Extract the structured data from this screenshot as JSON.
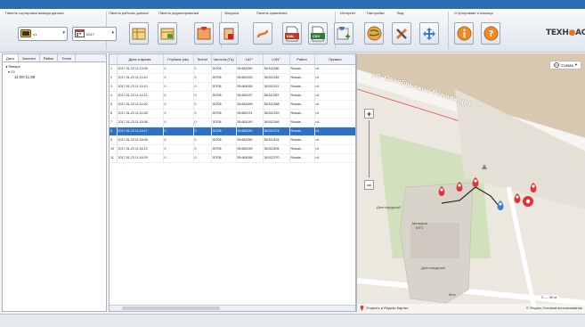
{
  "ribbon": {
    "groups": {
      "sort": "Панель сортировки вывода данных",
      "workspace": "Панель рабочих данных",
      "edit": "Панель редактирования",
      "load": "Загрузка",
      "compare": "Панель сравнения",
      "internet": "Интернет",
      "settings": "Настройки",
      "view": "Вид",
      "about": "О программе и помощь"
    },
    "device_select": {
      "value": "x1"
    },
    "year_select": {
      "value": "2017"
    },
    "buttons": {
      "kml": "KML",
      "csv": "CSV"
    },
    "logo": {
      "part1": "ТЕХН",
      "dot": "●",
      "part2": "АС"
    }
  },
  "left_panel": {
    "tabs": [
      "Дата",
      "Частота",
      "Район",
      "Тесты"
    ],
    "tree": {
      "month": "Январь",
      "day": "23",
      "interval": "11:00-11:59"
    }
  },
  "table": {
    "columns": [
      "",
      "Дата и время",
      "Глубина (км)",
      "TechId",
      "Частота (Гц)",
      "LAT°",
      "LON°",
      "Район",
      "Примеч."
    ],
    "rows": [
      [
        "1",
        "2017-01-23 11:13:08",
        "0",
        "0",
        "30708",
        "55.681050",
        "38.812280",
        "Russia...",
        "n1"
      ],
      [
        "2",
        "2017-01-23 11:13:10",
        "0",
        "0",
        "30708",
        "55.681053",
        "38.812282",
        "Russia...",
        "n1"
      ],
      [
        "3",
        "2017-01-23 11:14:10",
        "0",
        "0",
        "30708",
        "55.681055",
        "38.812311",
        "Russia...",
        "n1"
      ],
      [
        "4",
        "2017-01-23 11:14:13",
        "0",
        "0",
        "30708",
        "55.681037",
        "38.812357",
        "Russia...",
        "n1"
      ],
      [
        "5",
        "2017-01-23 11:14:20",
        "0",
        "0",
        "30708",
        "55.681069",
        "38.812368",
        "Russia...",
        "n1"
      ],
      [
        "6",
        "2017-01-23 11:14:28",
        "0",
        "0",
        "30708",
        "55.681074",
        "38.812339",
        "Russia...",
        "n1"
      ],
      [
        "7",
        "2017-01-23 11:15:08",
        "0",
        "0",
        "30708",
        "55.681049",
        "38.812346",
        "Russia...",
        "n1"
      ],
      [
        "8",
        "2017-01-23 11:15:17",
        "0",
        "0",
        "30708",
        "55.681050",
        "38.812374",
        "Russia...",
        "n1"
      ],
      [
        "9",
        "2017-01-23 11:16:08",
        "0",
        "0",
        "30708",
        "55.681050",
        "38.812404",
        "Russia...",
        "n1"
      ],
      [
        "10",
        "2017-01-23 11:16:13",
        "0",
        "0",
        "30708",
        "55.681049",
        "38.812406",
        "Russia...",
        "n1"
      ],
      [
        "11",
        "2017-01-23 11:16:29",
        "0",
        "0",
        "30708",
        "55.681056",
        "38.812370",
        "Russia...",
        "n1"
      ]
    ],
    "selected_row": 7
  },
  "map": {
    "street": "ул. Октябрьской Революции",
    "mode_button": "Схема",
    "zoom_in": "+",
    "zoom_out": "−",
    "pois": {
      "poi1": "Долгопрудный",
      "poi2": "Мегафон\nМТС",
      "poi3": "Долгопрудный",
      "poi4": "Мое"
    },
    "open_link": "Открыть в Яндекс.Картах",
    "scale": "0 — 40 м",
    "copyright": "© Яндекс Условия использования"
  },
  "colors": {
    "title_bar": "#2b6cb3",
    "selection": "#2f6fc6",
    "marker_red": "#e3323a",
    "marker_blue": "#3a7bd5",
    "logo_accent": "#e8731a"
  }
}
